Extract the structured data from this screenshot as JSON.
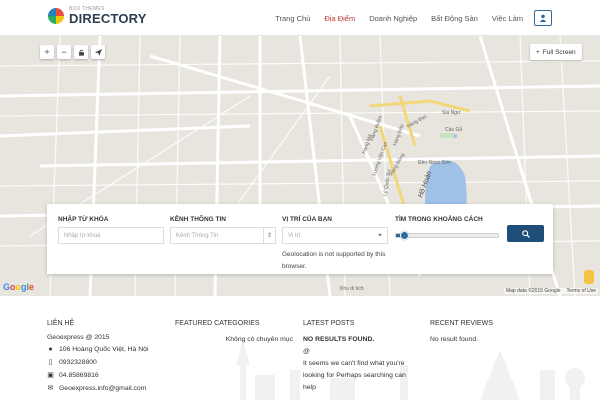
{
  "header": {
    "logo_sub": "BOX THEMES",
    "logo_main": "DIRECTORY",
    "nav": [
      "Trang Chủ",
      "Địa Điểm",
      "Doanh Nghiệp",
      "Bất Động Sản",
      "Việc Làm"
    ],
    "active_nav": "Địa Điểm",
    "user_icon": "user-icon"
  },
  "map": {
    "fullscreen_label": "Full Screen",
    "controls": [
      "plus-icon",
      "minus-icon",
      "lock-icon",
      "send-icon"
    ],
    "attribution": "Map data ©2015 Google",
    "terms": "Terms of Use",
    "google_logo": "Google",
    "labels": {
      "sia_ngu": "Sia Ngư",
      "cau_go": "Cầu Gỗ",
      "den_ngoc_son": "Đền Ngọc Sơn",
      "ho_hoan": "Hồ Hoàn",
      "hang_buom": "Hàng Buồm",
      "hang_dao": "Hàng Đào",
      "hang_bac": "Hàng Bạc",
      "hang_ma": "Hàng Mã",
      "hang_bong": "Hàng Bông",
      "luong_van_can": "Lương Văn Can",
      "ly_quoc_su": "Lý Quốc Sư",
      "khu_di_tich": "Khu di tích"
    }
  },
  "search": {
    "keyword_label": "Nhập từ khóa",
    "keyword_placeholder": "Nhập từ khoá",
    "channel_label": "Kênh thông tin",
    "channel_placeholder": "Kênh Thông Tin",
    "location_label": "Vị trí của bạn",
    "location_placeholder": "Vị trí",
    "geo_message": "Geolocation is not supported by this browser.",
    "distance_label": "Tìm trong khoảng cách",
    "distance_value": 0.08,
    "search_icon": "search-icon"
  },
  "footer": {
    "contact": {
      "title": "Liên hệ",
      "company": "Geoexpress @ 2015",
      "rows": [
        {
          "icon": "map-marker-icon",
          "text": "106 Hoàng Quốc Việt, Hà Nội"
        },
        {
          "icon": "mobile-icon",
          "text": "0932328800"
        },
        {
          "icon": "fax-icon",
          "text": "04.85869816"
        },
        {
          "icon": "envelope-icon",
          "text": "Geoexpress.info@gmail.com"
        }
      ]
    },
    "categories": {
      "title": "Featured categories",
      "item": "Không có chuyên mục"
    },
    "posts": {
      "title": "Latest posts",
      "heading": "NO RESULTS FOUND.",
      "icon": "@",
      "text": "It seems we can't find what you're looking for Perhaps searching can help"
    },
    "reviews": {
      "title": "Recent reviews",
      "text": "No result found."
    }
  }
}
